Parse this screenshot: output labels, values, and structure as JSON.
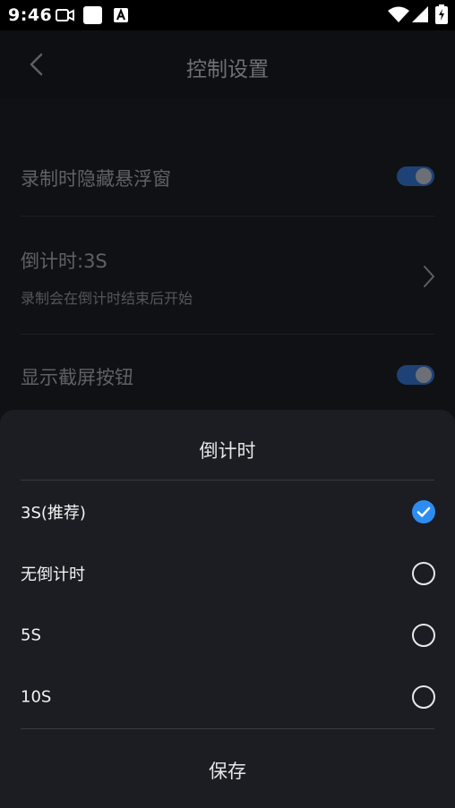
{
  "status_bar": {
    "time": "9:46",
    "icons": [
      "video-icon",
      "square-notification-icon",
      "a-notification-icon",
      "wifi-icon",
      "signal-icon",
      "battery-charging-icon"
    ]
  },
  "header": {
    "title": "控制设置",
    "back_icon": "chevron-left-icon"
  },
  "settings": {
    "hide_float_window": {
      "label": "录制时隐藏悬浮窗",
      "enabled": true
    },
    "countdown": {
      "label": "倒计时:3S",
      "description": "录制会在倒计时结束后开始"
    },
    "show_screenshot_button": {
      "label": "显示截屏按钮",
      "enabled": true
    }
  },
  "sheet": {
    "title": "倒计时",
    "options": [
      {
        "label": "3S(推荐)",
        "selected": true
      },
      {
        "label": "无倒计时",
        "selected": false
      },
      {
        "label": "5S",
        "selected": false
      },
      {
        "label": "10S",
        "selected": false
      }
    ],
    "save_label": "保存"
  },
  "colors": {
    "accent": "#2d8cf0",
    "sheet_bg": "#1c1d22",
    "page_bg": "#101114"
  }
}
